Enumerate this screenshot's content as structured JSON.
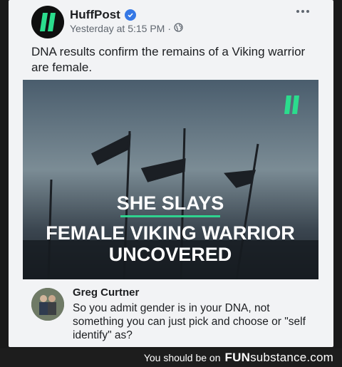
{
  "post": {
    "page_name": "HuffPost",
    "timestamp": "Yesterday at 5:15 PM",
    "separator": "·",
    "text": "DNA results confirm the remains of a Viking warrior are female.",
    "verified_icon": "verified-check-icon",
    "audience_icon": "globe-icon"
  },
  "media": {
    "headline_line1": "SHE SLAYS",
    "headline_line2": "FEMALE VIKING WARRIOR",
    "headline_line3": "UNCOVERED",
    "accent_color": "#2fd38f",
    "brand_color": "#2bdc8d"
  },
  "comment": {
    "author": "Greg Curtner",
    "text": "So you admit gender is in your DNA, not something you can just pick and choose or \"self identify\" as?"
  },
  "footer": {
    "prefix": "You should be on",
    "brand_bold": "FUN",
    "brand_rest": "substance.com"
  }
}
